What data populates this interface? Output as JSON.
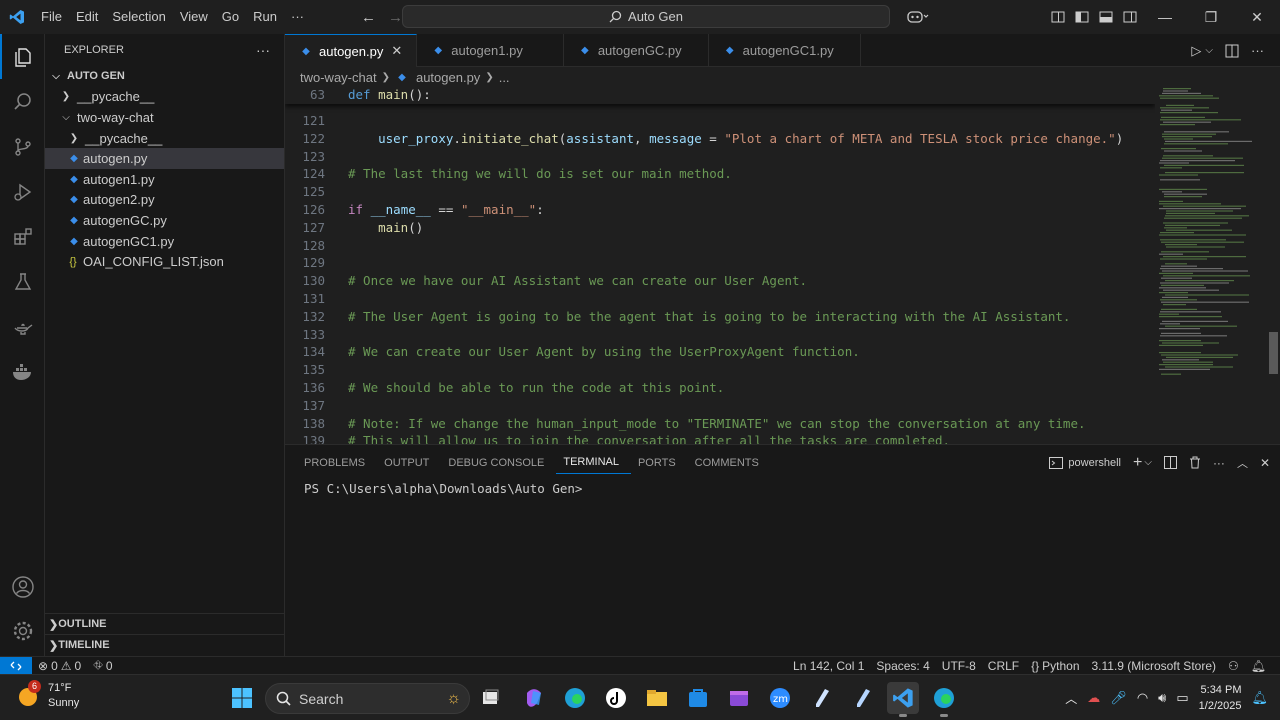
{
  "titlebar": {
    "menu": [
      "File",
      "Edit",
      "Selection",
      "View",
      "Go",
      "Run",
      "···"
    ],
    "search_label": "Auto Gen"
  },
  "sidebar": {
    "explorer_title": "EXPLORER",
    "more": "···",
    "root": "AUTO GEN",
    "items": [
      {
        "label": "__pycache__",
        "kind": "folder",
        "expanded": false,
        "indent": 1
      },
      {
        "label": "two-way-chat",
        "kind": "folder",
        "expanded": true,
        "indent": 1
      },
      {
        "label": "__pycache__",
        "kind": "folder",
        "expanded": false,
        "indent": 2
      },
      {
        "label": "autogen.py",
        "kind": "py",
        "indent": 2,
        "selected": true
      },
      {
        "label": "autogen1.py",
        "kind": "py",
        "indent": 2
      },
      {
        "label": "autogen2.py",
        "kind": "py",
        "indent": 2
      },
      {
        "label": "autogenGC.py",
        "kind": "py",
        "indent": 2
      },
      {
        "label": "autogenGC1.py",
        "kind": "py",
        "indent": 2
      },
      {
        "label": "OAI_CONFIG_LIST.json",
        "kind": "json",
        "indent": 2
      }
    ],
    "outline": "OUTLINE",
    "timeline": "TIMELINE"
  },
  "tabs": [
    {
      "label": "autogen.py",
      "active": true
    },
    {
      "label": "autogen1.py",
      "active": false
    },
    {
      "label": "autogenGC.py",
      "active": false
    },
    {
      "label": "autogenGC1.py",
      "active": false
    }
  ],
  "breadcrumb": {
    "folder": "two-way-chat",
    "file": "autogen.py",
    "more": "..."
  },
  "editor": {
    "sticky": {
      "ln": "63",
      "code": "def main():"
    },
    "lines": [
      {
        "ln": "121",
        "code": ""
      },
      {
        "ln": "122",
        "code": "    user_proxy.initiate_chat(assistant, message = \"Plot a chart of META and TESLA stock price change.\")"
      },
      {
        "ln": "123",
        "code": ""
      },
      {
        "ln": "124",
        "code": "# The last thing we will do is set our main method."
      },
      {
        "ln": "125",
        "code": ""
      },
      {
        "ln": "126",
        "code": "if __name__ == \"__main__\":"
      },
      {
        "ln": "127",
        "code": "    main()"
      },
      {
        "ln": "128",
        "code": ""
      },
      {
        "ln": "129",
        "code": ""
      },
      {
        "ln": "130",
        "code": "# Once we have our AI Assistant we can create our User Agent."
      },
      {
        "ln": "131",
        "code": ""
      },
      {
        "ln": "132",
        "code": "# The User Agent is going to be the agent that is going to be interacting with the AI Assistant."
      },
      {
        "ln": "133",
        "code": ""
      },
      {
        "ln": "134",
        "code": "# We can create our User Agent by using the UserProxyAgent function."
      },
      {
        "ln": "135",
        "code": ""
      },
      {
        "ln": "136",
        "code": "# We should be able to run the code at this point."
      },
      {
        "ln": "137",
        "code": ""
      },
      {
        "ln": "138",
        "code": "# Note: If we change the human_input_mode to \"TERMINATE\" we can stop the conversation at any time."
      },
      {
        "ln": "139",
        "code": "# This will allow us to join the conversation after all the tasks are completed."
      }
    ]
  },
  "panel": {
    "tabs": [
      "PROBLEMS",
      "OUTPUT",
      "DEBUG CONSOLE",
      "TERMINAL",
      "PORTS",
      "COMMENTS"
    ],
    "active_tab": "TERMINAL",
    "shell": "powershell",
    "prompt": "PS C:\\Users\\alpha\\Downloads\\Auto Gen>"
  },
  "statusbar": {
    "errors": "0",
    "warnings": "0",
    "ports": "0",
    "position": "Ln 142, Col 1",
    "spaces": "Spaces: 4",
    "encoding": "UTF-8",
    "eol": "CRLF",
    "language": "Python",
    "interpreter": "3.11.9 (Microsoft Store)"
  },
  "taskbar": {
    "weather_badge": "6",
    "temperature": "71°F",
    "condition": "Sunny",
    "search_placeholder": "Search",
    "time": "5:34 PM",
    "date": "1/2/2025"
  },
  "colors": {
    "accent": "#0078d4",
    "editor_bg": "#1f1f1f",
    "sidebar_bg": "#181818",
    "comment": "#6a9955",
    "string": "#ce9178",
    "keyword": "#569cd6",
    "function": "#dcdcaa",
    "variable": "#9cdcfe"
  }
}
